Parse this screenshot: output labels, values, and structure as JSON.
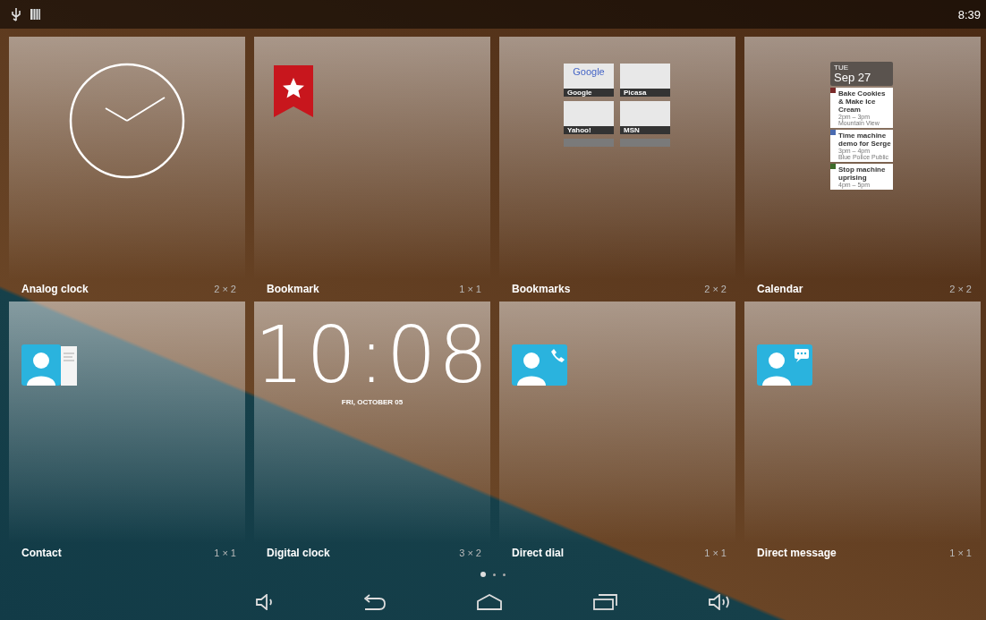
{
  "status_bar": {
    "time": "8:39"
  },
  "widgets": [
    {
      "name": "Analog clock",
      "size": "2 × 2",
      "kind": "analog_clock"
    },
    {
      "name": "Bookmark",
      "size": "1 × 1",
      "kind": "bookmark"
    },
    {
      "name": "Bookmarks",
      "size": "2 × 2",
      "kind": "bookmarks",
      "thumbnails": [
        {
          "label": "Google",
          "page_text": "Google"
        },
        {
          "label": "Picasa"
        },
        {
          "label": "Yahoo!"
        },
        {
          "label": "MSN"
        },
        {
          "cut": true
        },
        {
          "cut": true
        }
      ]
    },
    {
      "name": "Calendar",
      "size": "2 × 2",
      "kind": "calendar",
      "weekday": "TUE",
      "date": "Sep 27",
      "events": [
        {
          "title": "Bake Cookies & Make Ice Cream",
          "time": "2pm – 3pm",
          "place": "Mountain View",
          "color": "#7a2a2a"
        },
        {
          "title": "Time machine demo for Serge",
          "time": "3pm – 4pm",
          "place": "Blue Police Public",
          "color": "#4a6bb0"
        },
        {
          "title": "Stop machine uprising",
          "time": "4pm – 5pm",
          "color": "#3d6b2a"
        }
      ]
    },
    {
      "name": "Contact",
      "size": "1 × 1",
      "kind": "contact"
    },
    {
      "name": "Digital clock",
      "size": "3 × 2",
      "kind": "digital_clock",
      "clock": "10:08",
      "date": "FRI, OCTOBER 05"
    },
    {
      "name": "Direct dial",
      "size": "1 × 1",
      "kind": "direct_dial"
    },
    {
      "name": "Direct message",
      "size": "1 × 1",
      "kind": "direct_message"
    }
  ],
  "pages": [
    {
      "selected": true
    },
    {
      "selected": false
    },
    {
      "selected": false
    }
  ],
  "nav_buttons": [
    {
      "kind": "volume_down"
    },
    {
      "kind": "back"
    },
    {
      "kind": "home"
    },
    {
      "kind": "recents"
    },
    {
      "kind": "volume_up"
    }
  ]
}
